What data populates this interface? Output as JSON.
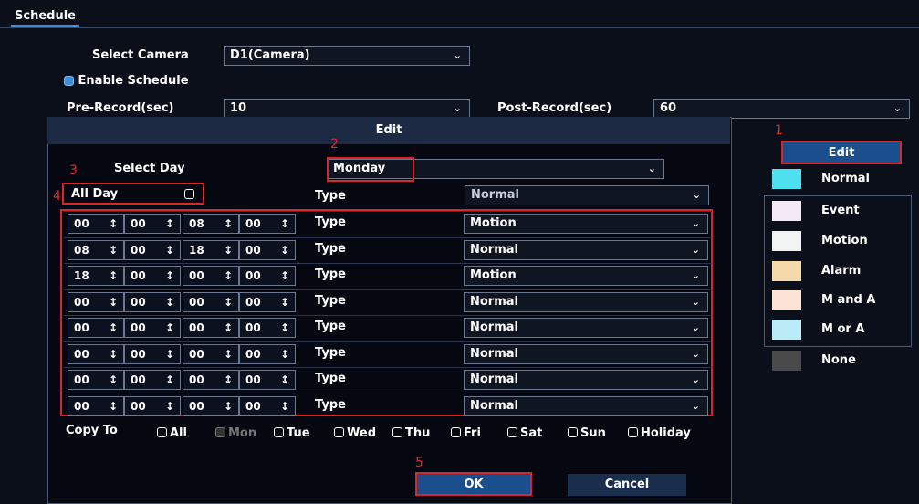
{
  "tab": {
    "label": "Schedule"
  },
  "form": {
    "select_camera_label": "Select Camera",
    "camera_value": "D1(Camera)",
    "enable_schedule_label": "Enable Schedule",
    "pre_record_label": "Pre-Record(sec)",
    "pre_record_value": "10",
    "post_record_label": "Post-Record(sec)",
    "post_record_value": "60"
  },
  "side": {
    "edit_label": "Edit",
    "legend": [
      {
        "label": "Normal",
        "color": "#4fe0f0"
      },
      {
        "label": "Event",
        "color": "#f3e9f7"
      },
      {
        "label": "Motion",
        "color": "#f1f4f2"
      },
      {
        "label": "Alarm",
        "color": "#f5d9a8"
      },
      {
        "label": "M and A",
        "color": "#fbe4d6"
      },
      {
        "label": "M or A",
        "color": "#b9ecf7"
      },
      {
        "label": "None",
        "color": "#4a4a4a"
      }
    ]
  },
  "dialog": {
    "title": "Edit",
    "select_day_label": "Select Day",
    "day_value": "Monday",
    "all_day_label": "All Day",
    "all_day_type_label": "Type",
    "all_day_type_value": "Normal",
    "rows": [
      {
        "sh": "00",
        "sm": "00",
        "eh": "08",
        "em": "00",
        "type_label": "Type",
        "type": "Motion"
      },
      {
        "sh": "08",
        "sm": "00",
        "eh": "18",
        "em": "00",
        "type_label": "Type",
        "type": "Normal"
      },
      {
        "sh": "18",
        "sm": "00",
        "eh": "00",
        "em": "00",
        "type_label": "Type",
        "type": "Motion"
      },
      {
        "sh": "00",
        "sm": "00",
        "eh": "00",
        "em": "00",
        "type_label": "Type",
        "type": "Normal"
      },
      {
        "sh": "00",
        "sm": "00",
        "eh": "00",
        "em": "00",
        "type_label": "Type",
        "type": "Normal"
      },
      {
        "sh": "00",
        "sm": "00",
        "eh": "00",
        "em": "00",
        "type_label": "Type",
        "type": "Normal"
      },
      {
        "sh": "00",
        "sm": "00",
        "eh": "00",
        "em": "00",
        "type_label": "Type",
        "type": "Normal"
      },
      {
        "sh": "00",
        "sm": "00",
        "eh": "00",
        "em": "00",
        "type_label": "Type",
        "type": "Normal"
      }
    ],
    "copy_to_label": "Copy To",
    "copy_days": [
      {
        "label": "All",
        "checked": false,
        "disabled": false
      },
      {
        "label": "Mon",
        "checked": true,
        "disabled": true
      },
      {
        "label": "Tue",
        "checked": false,
        "disabled": false
      },
      {
        "label": "Wed",
        "checked": false,
        "disabled": false
      },
      {
        "label": "Thu",
        "checked": false,
        "disabled": false
      },
      {
        "label": "Fri",
        "checked": false,
        "disabled": false
      },
      {
        "label": "Sat",
        "checked": false,
        "disabled": false
      },
      {
        "label": "Sun",
        "checked": false,
        "disabled": false
      },
      {
        "label": "Holiday",
        "checked": false,
        "disabled": false
      }
    ],
    "ok_label": "OK",
    "cancel_label": "Cancel"
  },
  "annotations": [
    "1",
    "2",
    "3",
    "4",
    "5"
  ],
  "colors": {
    "accent": "#3d8fd9",
    "annotation_red": "#d8262b"
  }
}
